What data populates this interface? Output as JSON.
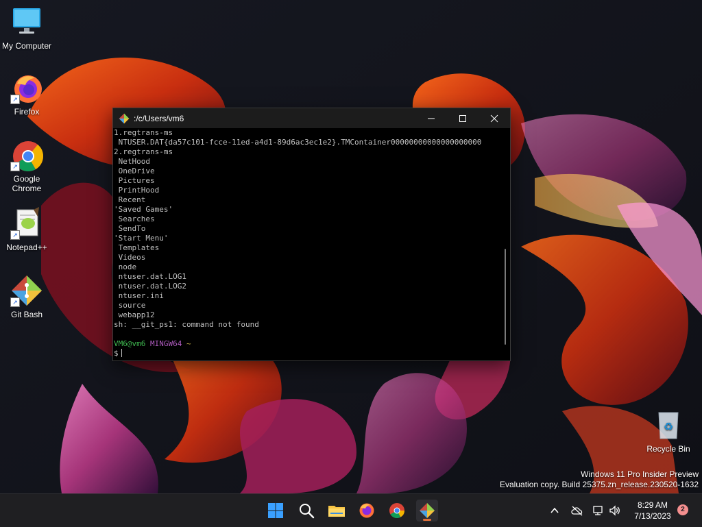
{
  "desktop": {
    "icons": [
      {
        "label": "My Computer"
      },
      {
        "label": "Firefox"
      },
      {
        "label_line1": "Google",
        "label_line2": "Chrome"
      },
      {
        "label": "Notepad++"
      },
      {
        "label": "Git Bash"
      }
    ],
    "recycle_bin": {
      "label": "Recycle Bin"
    }
  },
  "terminal": {
    "title": ":/c/Users/vm6",
    "lines": [
      "1.regtrans-ms",
      " NTUSER.DAT{da57c101-fcce-11ed-a4d1-89d6ac3ec1e2}.TMContainer00000000000000000000",
      "2.regtrans-ms",
      " NetHood",
      " OneDrive",
      " Pictures",
      " PrintHood",
      " Recent",
      "'Saved Games'",
      " Searches",
      " SendTo",
      "'Start Menu'",
      " Templates",
      " Videos",
      " node",
      " ntuser.dat.LOG1",
      " ntuser.dat.LOG2",
      " ntuser.ini",
      " source",
      " webapp12",
      "sh: __git_ps1: command not found",
      ""
    ],
    "prompt": {
      "user": "VM6@vm6",
      "system": "MINGW64",
      "path": "~",
      "symbol": "$"
    }
  },
  "watermark": {
    "line1": "Windows 11 Pro Insider Preview",
    "line2": "Evaluation copy. Build 25375.zn_release.230520-1632"
  },
  "taskbar": {
    "apps": [
      "windows-start",
      "search",
      "file-explorer",
      "firefox",
      "chrome",
      "git-bash"
    ],
    "active_app": "git-bash"
  },
  "clock": {
    "time": "8:29 AM",
    "date": "7/13/2023"
  },
  "notifications": {
    "count": "2"
  },
  "colors": {
    "accent": "#e0703a",
    "prompt_user": "#3fb950",
    "prompt_system": "#b05cc0",
    "prompt_path": "#c8b24a"
  }
}
